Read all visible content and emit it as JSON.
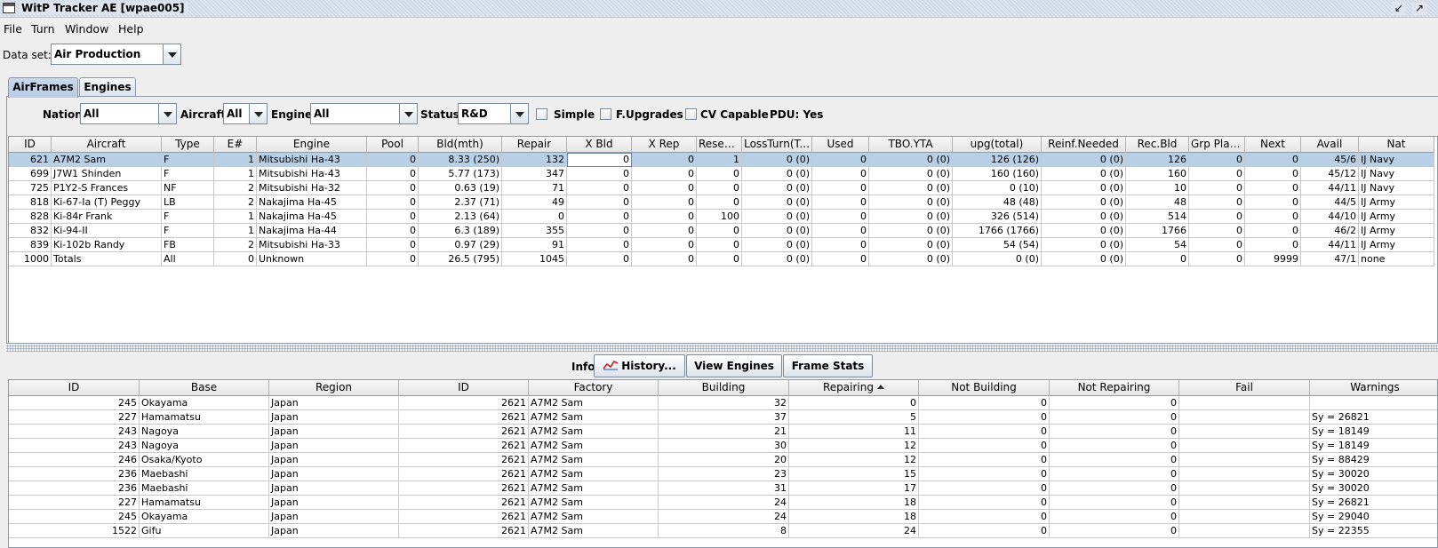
{
  "window": {
    "title": "WitP Tracker AE [wpae005]"
  },
  "menu": [
    "File",
    "Turn",
    "Window",
    "Help"
  ],
  "dataset": {
    "label": "Data set:",
    "value": "Air Production"
  },
  "tabs": [
    "AirFrames",
    "Engines"
  ],
  "filters": {
    "nation_label": "Nation:",
    "nation_value": "All",
    "aircraft_label": "Aircraft:",
    "aircraft_value": "All",
    "engine_label": "Engine:",
    "engine_value": "All",
    "status_label": "Status:",
    "status_value": "R&D",
    "simple_label": "Simple",
    "fupgrades_label": "F.Upgrades",
    "cv_label": "CV Capable",
    "pdu_label": "PDU: Yes"
  },
  "upper_table": {
    "columns": [
      "ID",
      "Aircraft",
      "Type",
      "E#",
      "Engine",
      "Pool",
      "Bld(mth)",
      "Repair",
      "X Bld",
      "X Rep",
      "Resea...",
      "LossTurn(T...",
      "Used",
      "TBO.YTA",
      "upg(total)",
      "Reinf.Needed",
      "Rec.Bld",
      "Grp Planes",
      "Next",
      "Avail",
      "Nat"
    ],
    "rows": [
      [
        "621",
        "A7M2 Sam",
        "F",
        "1",
        "Mitsubishi Ha-43",
        "0",
        "8.33 (250)",
        "132",
        "0",
        "0",
        "1",
        "0 (0)",
        "0",
        "0 (0)",
        "126 (126)",
        "0 (0)",
        "126",
        "0",
        "0",
        "45/6",
        "IJ Navy"
      ],
      [
        "699",
        "J7W1 Shinden",
        "F",
        "1",
        "Mitsubishi Ha-43",
        "0",
        "5.77 (173)",
        "347",
        "0",
        "0",
        "0",
        "0 (0)",
        "0",
        "0 (0)",
        "160 (160)",
        "0 (0)",
        "160",
        "0",
        "0",
        "45/12",
        "IJ Navy"
      ],
      [
        "725",
        "P1Y2-S Frances",
        "NF",
        "2",
        "Mitsubishi Ha-32",
        "0",
        "0.63 (19)",
        "71",
        "0",
        "0",
        "0",
        "0 (0)",
        "0",
        "0 (0)",
        "0 (10)",
        "0 (0)",
        "10",
        "0",
        "0",
        "44/11",
        "IJ Navy"
      ],
      [
        "818",
        "Ki-67-Ia (T) Peggy",
        "LB",
        "2",
        "Nakajima Ha-45",
        "0",
        "2.37 (71)",
        "49",
        "0",
        "0",
        "0",
        "0 (0)",
        "0",
        "0 (0)",
        "48 (48)",
        "0 (0)",
        "48",
        "0",
        "0",
        "44/5",
        "IJ Army"
      ],
      [
        "828",
        "Ki-84r Frank",
        "F",
        "1",
        "Nakajima Ha-45",
        "0",
        "2.13 (64)",
        "0",
        "0",
        "0",
        "100",
        "0 (0)",
        "0",
        "0 (0)",
        "326 (514)",
        "0 (0)",
        "514",
        "0",
        "0",
        "44/10",
        "IJ Army"
      ],
      [
        "832",
        "Ki-94-II",
        "F",
        "1",
        "Nakajima Ha-44",
        "0",
        "6.3 (189)",
        "355",
        "0",
        "0",
        "0",
        "0 (0)",
        "0",
        "0 (0)",
        "1766 (1766)",
        "0 (0)",
        "1766",
        "0",
        "0",
        "46/2",
        "IJ Army"
      ],
      [
        "839",
        "Ki-102b Randy",
        "FB",
        "2",
        "Mitsubishi Ha-33",
        "0",
        "0.97 (29)",
        "91",
        "0",
        "0",
        "0",
        "0 (0)",
        "0",
        "0 (0)",
        "54 (54)",
        "0 (0)",
        "54",
        "0",
        "0",
        "44/11",
        "IJ Army"
      ],
      [
        "1000",
        "Totals",
        "All",
        "0",
        "Unknown",
        "0",
        "26.5 (795)",
        "1045",
        "0",
        "0",
        "0",
        "0 (0)",
        "0",
        "0 (0)",
        "0 (0)",
        "0 (0)",
        "0",
        "0",
        "9999",
        "47/1",
        "none"
      ]
    ]
  },
  "info": {
    "label": "Info:",
    "history_button": "History...",
    "view_engines_button": "View Engines",
    "frame_stats_button": "Frame Stats"
  },
  "lower_table": {
    "columns": [
      "ID",
      "Base",
      "Region",
      "ID",
      "Factory",
      "Building",
      "Repairing",
      "Not Building",
      "Not Repairing",
      "Fail",
      "Warnings"
    ],
    "rows": [
      [
        "245",
        "Okayama",
        "Japan",
        "2621",
        "A7M2 Sam",
        "32",
        "0",
        "0",
        "0",
        "",
        ""
      ],
      [
        "227",
        "Hamamatsu",
        "Japan",
        "2621",
        "A7M2 Sam",
        "37",
        "5",
        "0",
        "0",
        "",
        "Sy = 26821"
      ],
      [
        "243",
        "Nagoya",
        "Japan",
        "2621",
        "A7M2 Sam",
        "21",
        "11",
        "0",
        "0",
        "",
        "Sy = 18149"
      ],
      [
        "243",
        "Nagoya",
        "Japan",
        "2621",
        "A7M2 Sam",
        "30",
        "12",
        "0",
        "0",
        "",
        "Sy = 18149"
      ],
      [
        "246",
        "Osaka/Kyoto",
        "Japan",
        "2621",
        "A7M2 Sam",
        "20",
        "12",
        "0",
        "0",
        "",
        "Sy = 88429"
      ],
      [
        "236",
        "Maebashi",
        "Japan",
        "2621",
        "A7M2 Sam",
        "23",
        "15",
        "0",
        "0",
        "",
        "Sy = 30020"
      ],
      [
        "236",
        "Maebashi",
        "Japan",
        "2621",
        "A7M2 Sam",
        "31",
        "17",
        "0",
        "0",
        "",
        "Sy = 30020"
      ],
      [
        "227",
        "Hamamatsu",
        "Japan",
        "2621",
        "A7M2 Sam",
        "24",
        "18",
        "0",
        "0",
        "",
        "Sy = 26821"
      ],
      [
        "245",
        "Okayama",
        "Japan",
        "2621",
        "A7M2 Sam",
        "24",
        "18",
        "0",
        "0",
        "",
        "Sy = 29040"
      ],
      [
        "1522",
        "Gifu",
        "Japan",
        "2621",
        "A7M2 Sam",
        "8",
        "24",
        "0",
        "0",
        "",
        "Sy = 22355"
      ]
    ]
  }
}
